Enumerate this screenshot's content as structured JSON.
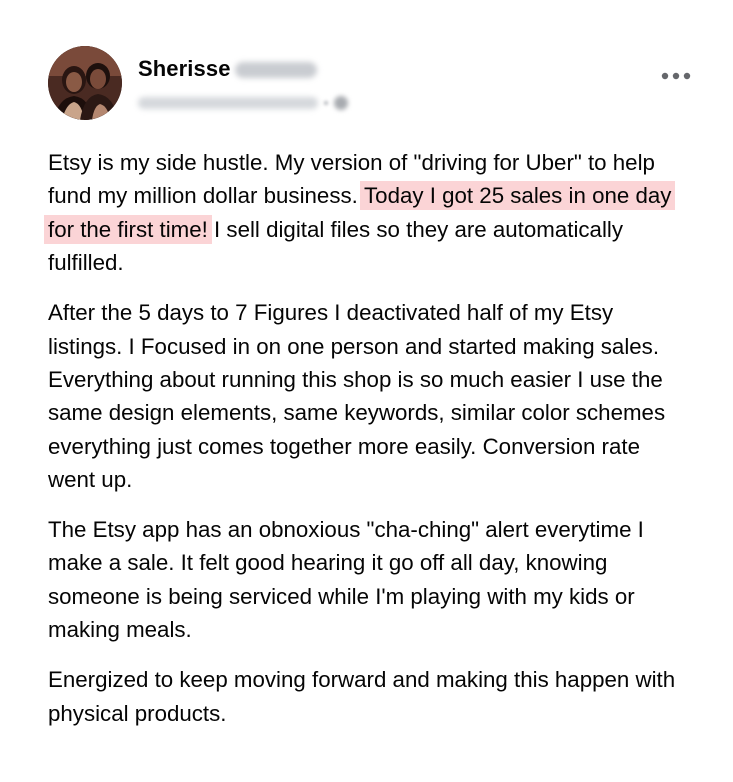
{
  "post": {
    "author": {
      "first_name": "Sherisse"
    },
    "more_icon": "more-horizontal-icon",
    "paragraphs": [
      {
        "before": "Etsy is my side hustle. My version of \"driving for Uber\" to help fund my million dollar business. ",
        "highlight": "Today I got 25 sales in one day for the first time!",
        "after": " I sell digital files so they are automatically fulfilled."
      },
      {
        "text": "After the 5 days to 7 Figures I deactivated half of my Etsy listings. I Focused in on one person and started making sales. Everything about running this shop is so much easier I use the same design elements, same keywords, similar color schemes everything just comes together more easily. Conversion rate went up."
      },
      {
        "text": "The Etsy app has an obnoxious \"cha-ching\" alert everytime I make a sale. It felt good hearing it go off all day, knowing someone is being serviced while I'm playing with my kids or making meals."
      },
      {
        "text": "Energized to keep moving forward and making this happen with physical products."
      }
    ],
    "colors": {
      "highlight": "#fbd4d6",
      "text": "#050505",
      "muted": "#65676b"
    }
  }
}
